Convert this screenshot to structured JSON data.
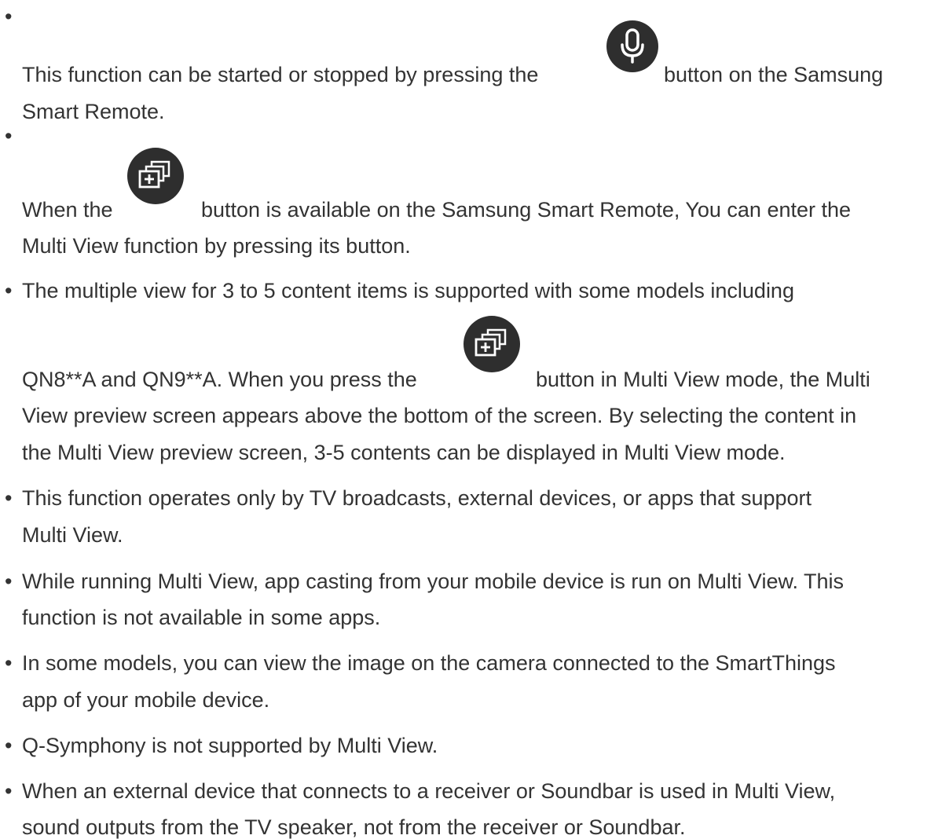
{
  "bullet_glyph": "•",
  "items": [
    {
      "lines": [
        "This function can be started or stopped by pressing the",
        "button on the Samsung",
        "Smart Remote."
      ],
      "icon": "microphone-icon"
    },
    {
      "lines": [
        "When the",
        "button is available on the Samsung Smart Remote, You can enter the",
        "Multi View function by pressing its button."
      ],
      "icon": "multi-view-icon"
    },
    {
      "lines": [
        "The multiple view for 3 to 5 content items is supported with some models including",
        "QN8**A and QN9**A. When you press the",
        "button in Multi View mode, the Multi",
        "View preview screen appears above the bottom of the screen. By selecting the content in",
        "the Multi View preview screen, 3-5 contents can be displayed in Multi View mode."
      ],
      "icon": "multi-view-icon"
    },
    {
      "lines": [
        "This function operates only by TV broadcasts, external devices, or apps that support",
        "Multi View."
      ]
    },
    {
      "lines": [
        "While running Multi View, app casting from your mobile device is run on Multi View. This",
        "function is not available in some apps."
      ]
    },
    {
      "lines": [
        "In some models, you can view the image on the camera connected to the SmartThings",
        "app of your mobile device."
      ]
    },
    {
      "lines": [
        "Q-Symphony is not supported by Multi View."
      ]
    },
    {
      "lines": [
        "When an external device that connects to a receiver or Soundbar is used in Multi View,",
        "sound outputs from the TV speaker, not from the receiver or Soundbar."
      ]
    }
  ],
  "colors": {
    "text": "#333333",
    "icon_background": "#2e2e2e",
    "icon_glyph": "#ffffff"
  }
}
